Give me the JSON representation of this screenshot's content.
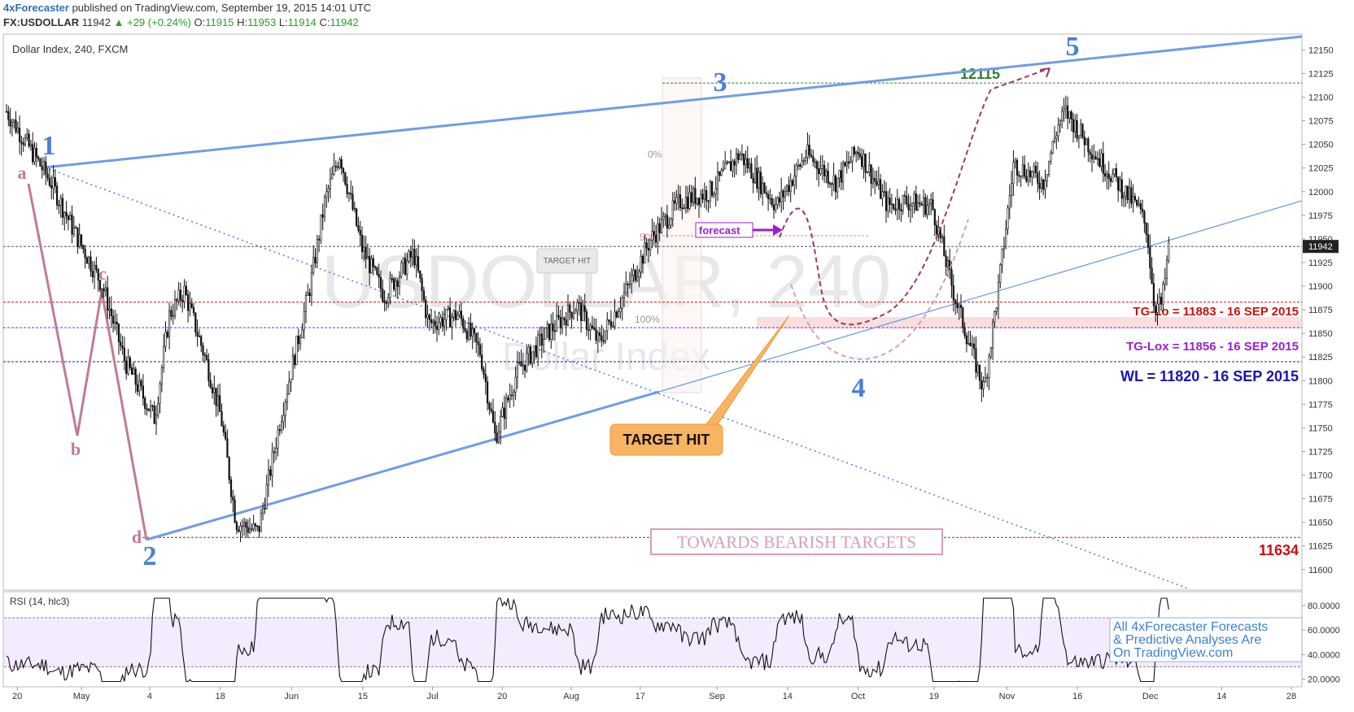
{
  "header": {
    "brand": "4xForecaster",
    "published": "published on TradingView.com, September 19, 2015 14:01 UTC",
    "symbol": "FX:USDOLLAR",
    "last": "11942",
    "change": "+29 (+0.24%)",
    "o_label": "O:",
    "o": "11915",
    "h_label": "H:",
    "h": "11953",
    "l_label": "L:",
    "l": "11914",
    "c_label": "C:",
    "c": "11942"
  },
  "chart_data": [
    {
      "type": "candlestick",
      "title": "Dollar Index, 240, FXCM",
      "watermark_symbol": "USDOLLAR, 240",
      "watermark_name": "Dollar Index",
      "ylim": [
        11580,
        12165
      ],
      "y_ticks": [
        12150,
        12125,
        12100,
        12075,
        12050,
        12025,
        12000,
        11975,
        11950,
        11925,
        11900,
        11875,
        11850,
        11825,
        11800,
        11775,
        11750,
        11725,
        11700,
        11675,
        11650,
        11625,
        11600
      ],
      "x_ticks": [
        "20",
        "May",
        "4",
        "18",
        "Jun",
        "15",
        "Jul",
        "20",
        "Aug",
        "17",
        "Sep",
        "14",
        "Oct",
        "19",
        "Nov",
        "16",
        "Dec",
        "14",
        "28"
      ],
      "last_price": "11942",
      "price_path": [
        [
          "2015-04-14",
          12085
        ],
        [
          "2015-04-20",
          12010
        ],
        [
          "2015-04-23",
          11960
        ],
        [
          "2015-04-27",
          11900
        ],
        [
          "2015-04-30",
          11820
        ],
        [
          "2015-05-04",
          11760
        ],
        [
          "2015-05-06",
          11870
        ],
        [
          "2015-05-08",
          11895
        ],
        [
          "2015-05-11",
          11820
        ],
        [
          "2015-05-13",
          11760
        ],
        [
          "2015-05-15",
          11650
        ],
        [
          "2015-05-18",
          11640
        ],
        [
          "2015-05-21",
          11760
        ],
        [
          "2015-05-25",
          11900
        ],
        [
          "2015-05-27",
          11990
        ],
        [
          "2015-05-29",
          12040
        ],
        [
          "2015-06-01",
          11940
        ],
        [
          "2015-06-04",
          11890
        ],
        [
          "2015-06-08",
          11935
        ],
        [
          "2015-06-10",
          11860
        ],
        [
          "2015-06-14",
          11870
        ],
        [
          "2015-06-17",
          11830
        ],
        [
          "2015-06-19",
          11740
        ],
        [
          "2015-06-22",
          11810
        ],
        [
          "2015-06-26",
          11850
        ],
        [
          "2015-06-30",
          11880
        ],
        [
          "2015-07-03",
          11840
        ],
        [
          "2015-07-07",
          11900
        ],
        [
          "2015-07-10",
          11950
        ],
        [
          "2015-07-14",
          11990
        ],
        [
          "2015-07-18",
          12000
        ],
        [
          "2015-07-22",
          12040
        ],
        [
          "2015-07-27",
          11985
        ],
        [
          "2015-07-31",
          12040
        ],
        [
          "2015-08-04",
          12010
        ],
        [
          "2015-08-07",
          12045
        ],
        [
          "2015-08-11",
          11985
        ],
        [
          "2015-08-13",
          11990
        ],
        [
          "2015-08-17",
          11985
        ],
        [
          "2015-08-20",
          11890
        ],
        [
          "2015-08-24",
          11790
        ],
        [
          "2015-08-26",
          11900
        ],
        [
          "2015-08-28",
          12030
        ],
        [
          "2015-09-01",
          12010
        ],
        [
          "2015-09-03",
          12070
        ],
        [
          "2015-09-04",
          12085
        ],
        [
          "2015-09-08",
          12040
        ],
        [
          "2015-09-10",
          12020
        ],
        [
          "2015-09-14",
          11980
        ],
        [
          "2015-09-15",
          11960
        ],
        [
          "2015-09-16",
          11880
        ],
        [
          "2015-09-17",
          11880
        ],
        [
          "2015-09-18",
          11942
        ]
      ],
      "horizontal_levels": [
        {
          "value": 12115,
          "label": "12115",
          "color": "#2e7d32"
        },
        {
          "value": 11942,
          "label": "",
          "color": "#555555"
        },
        {
          "value": 11883,
          "label": "TG-Lo = 11883 - 16 SEP 2015",
          "color": "#cc1111"
        },
        {
          "value": 11856,
          "label": "TG-Lox = 11856 - 16 SEP 2015",
          "color": "#9b1fd1"
        },
        {
          "value": 11820,
          "label": "WL = 11820 - 16 SEP 2015",
          "color": "#1515b5"
        },
        {
          "value": 11634,
          "label": "11634",
          "color": "#cc1111"
        }
      ],
      "wave_labels": {
        "impulse": [
          "1",
          "2",
          "3",
          "4",
          "5"
        ],
        "corrective": [
          "a",
          "b",
          "c",
          "d"
        ]
      },
      "fib_labels": [
        "0%",
        "50%",
        "100%"
      ],
      "annotations": {
        "forecast": "forecast",
        "target_hit_small": "TARGET HIT",
        "target_hit": "TARGET HIT",
        "bearish": "TOWARDS BEARISH TARGETS"
      }
    },
    {
      "type": "line",
      "title": "RSI (14, hlc3)",
      "ylim": [
        15,
        90
      ],
      "y_ticks": [
        "80.0000",
        "60.0000",
        "40.0000",
        "20.0000"
      ],
      "bands": [
        70,
        30
      ],
      "note_lines": [
        "All 4xForecaster Forecasts",
        "& Predictive Analyses Are",
        "On TradingView.com"
      ]
    }
  ],
  "colors": {
    "channel": "#4a7fd8",
    "wave_blue": "#4a7fd8",
    "wave_pink": "#c07a9a",
    "forecast_purple": "#9b1fd1",
    "forecast_path": "#9b3a5e",
    "rsi_band": "#f4ebff"
  }
}
